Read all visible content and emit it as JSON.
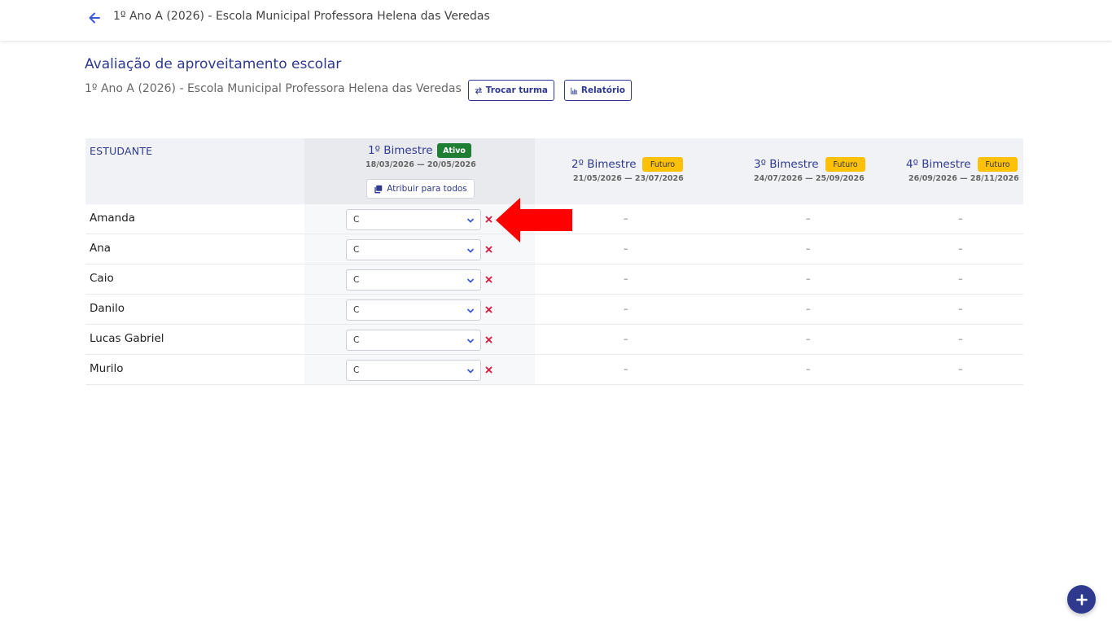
{
  "topbar": {
    "title": "1º Ano A (2026) - Escola Municipal Professora Helena das Veredas"
  },
  "header": {
    "title": "Avaliação de aproveitamento escolar",
    "subtitle": "1º Ano A (2026) - Escola Municipal Professora Helena das Veredas",
    "trocar_label": "Trocar turma",
    "relatorio_label": "Relatório"
  },
  "table": {
    "student_header": "ESTUDANTE",
    "assign_all_label": "Atribuir para todos",
    "empty_cell": "–",
    "periods": [
      {
        "title": "1º Bimestre",
        "status": "Ativo",
        "dates": "18/03/2026 — 20/05/2026"
      },
      {
        "title": "2º Bimestre",
        "status": "Futuro",
        "dates": "21/05/2026 — 23/07/2026"
      },
      {
        "title": "3º Bimestre",
        "status": "Futuro",
        "dates": "24/07/2026 — 25/09/2026"
      },
      {
        "title": "4º Bimestre",
        "status": "Futuro",
        "dates": "26/09/2026 — 28/11/2026"
      }
    ],
    "rows": [
      {
        "name": "Amanda",
        "grade": "C"
      },
      {
        "name": "Ana",
        "grade": "C"
      },
      {
        "name": "Caio",
        "grade": "C"
      },
      {
        "name": "Danilo",
        "grade": "C"
      },
      {
        "name": "Lucas Gabriel",
        "grade": "C"
      },
      {
        "name": "Murilo",
        "grade": "C"
      }
    ]
  },
  "colors": {
    "primary": "#2f3a8f",
    "active_badge": "#1e7e34",
    "future_badge": "#ffc107",
    "clear_icon": "#e0183c",
    "annotation_arrow": "#ff0000"
  },
  "icons": [
    "arrow-left-icon",
    "swap-icon",
    "bar-chart-icon",
    "copy-icon",
    "chevron-down-icon",
    "close-icon",
    "plus-icon"
  ]
}
